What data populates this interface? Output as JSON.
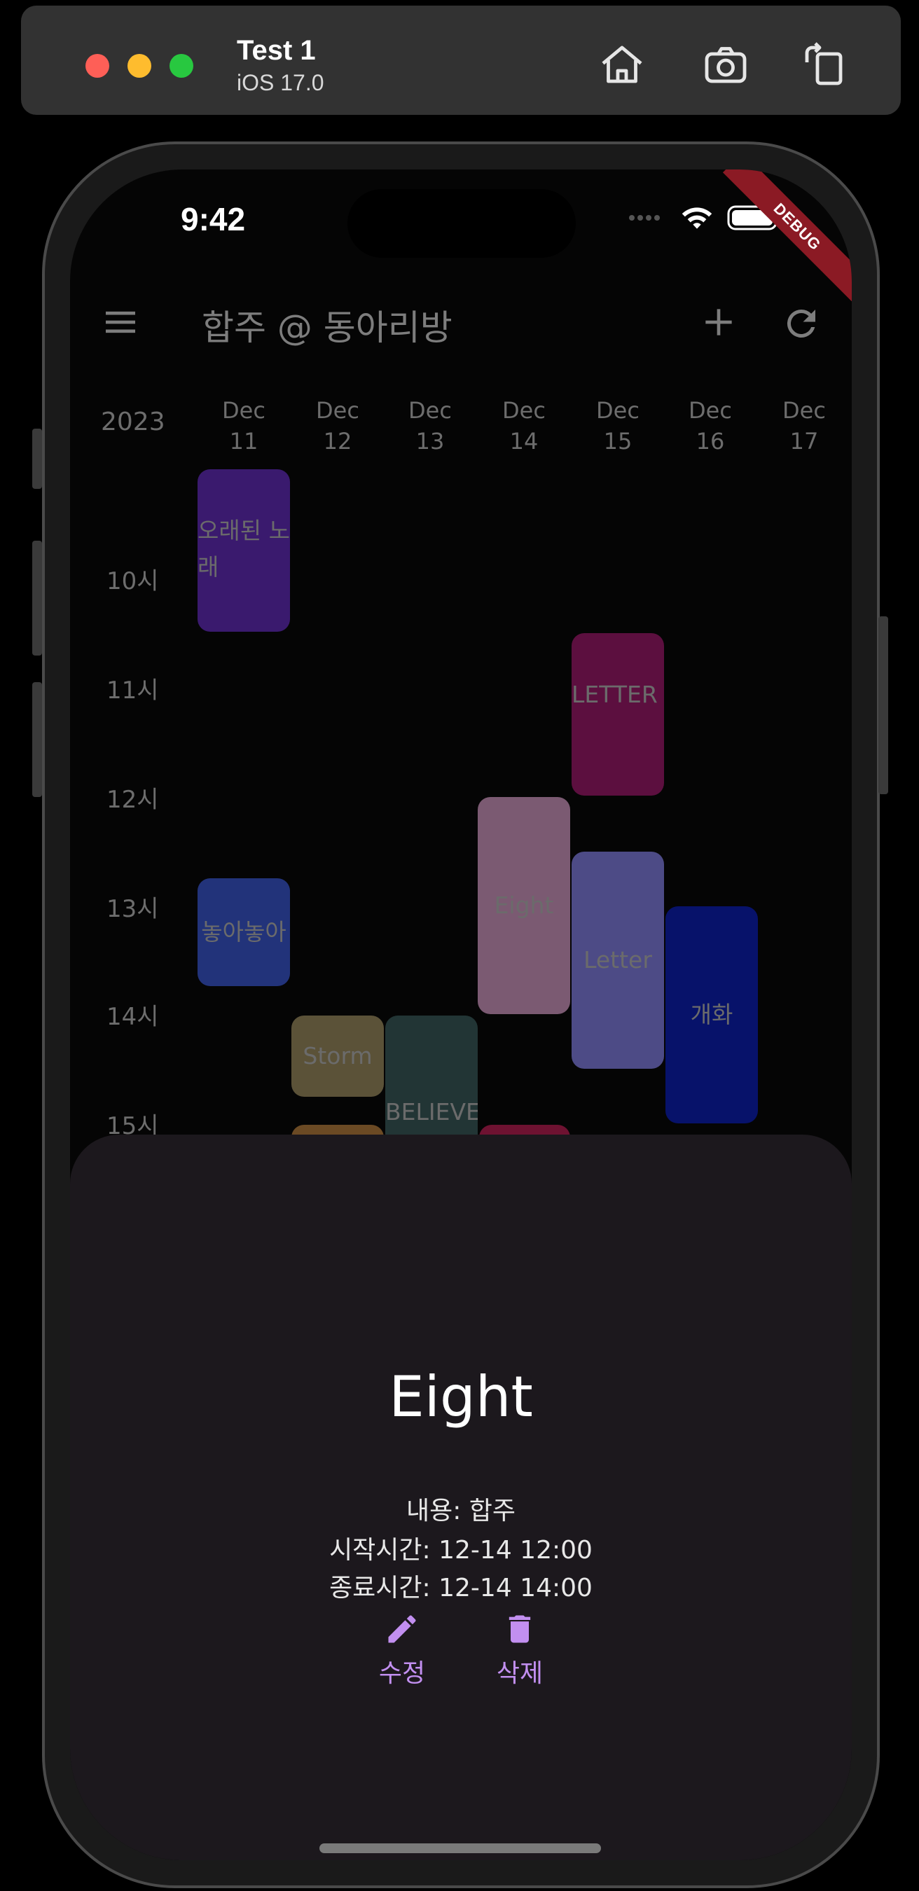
{
  "simulator": {
    "device_name": "Test 1",
    "os_version": "iOS 17.0",
    "buttons": [
      "home-icon",
      "screenshot-icon",
      "rotate-icon"
    ],
    "light_colors": {
      "red": "#fe5f57",
      "yellow": "#febc2e",
      "green": "#28c840"
    }
  },
  "status_bar": {
    "time": "9:42",
    "debug_label": "DEBUG"
  },
  "app_bar": {
    "title": "합주 @ 동아리방"
  },
  "calendar": {
    "year": "2023",
    "days": [
      {
        "month": "Dec",
        "day": "11"
      },
      {
        "month": "Dec",
        "day": "12"
      },
      {
        "month": "Dec",
        "day": "13"
      },
      {
        "month": "Dec",
        "day": "14"
      },
      {
        "month": "Dec",
        "day": "15"
      },
      {
        "month": "Dec",
        "day": "16"
      },
      {
        "month": "Dec",
        "day": "17"
      }
    ],
    "hours": [
      "10시",
      "11시",
      "12시",
      "13시",
      "14시",
      "15시"
    ],
    "events": [
      {
        "title": "오래된 노래",
        "day": "Dec 11",
        "start": "09:35",
        "end": "11:05",
        "color": "#3a1a6e"
      },
      {
        "title": "LETTER",
        "day": "Dec 15",
        "start": "11:05",
        "end": "12:35",
        "color": "#5c0f3f"
      },
      {
        "title": "Eight",
        "day": "Dec 14",
        "start": "12:35",
        "end": "14:35",
        "color": "#7b5a72"
      },
      {
        "title": "놓아놓아",
        "day": "Dec 11",
        "start": "13:20",
        "end": "14:20",
        "color": "#22337a"
      },
      {
        "title": "Letter",
        "day": "Dec 15",
        "start": "13:05",
        "end": "15:05",
        "color": "#4d4b86"
      },
      {
        "title": "개화",
        "day": "Dec 16",
        "start": "13:35",
        "end": "15:35",
        "color": "#07126a"
      },
      {
        "title": "Storm",
        "day": "Dec 12",
        "start": "14:35",
        "end": "15:20",
        "color": "#5b5238"
      },
      {
        "title": "BELIEVE",
        "day": "Dec 13",
        "start": "14:35",
        "end": "15:50",
        "color": "#223535"
      },
      {
        "title": "",
        "day": "Dec 12",
        "start": "15:35",
        "end": "16:00",
        "color": "#6b4a24"
      },
      {
        "title": "",
        "day": "Dec 14",
        "start": "15:35",
        "end": "16:00",
        "color": "#6e1231"
      }
    ]
  },
  "sheet": {
    "title": "Eight",
    "content_line": "내용: 합주",
    "start_line": "시작시간: 12-14 12:00",
    "end_line": "종료시간: 12-14 14:00",
    "edit_label": "수정",
    "delete_label": "삭제",
    "accent_color": "#c28ff0"
  }
}
